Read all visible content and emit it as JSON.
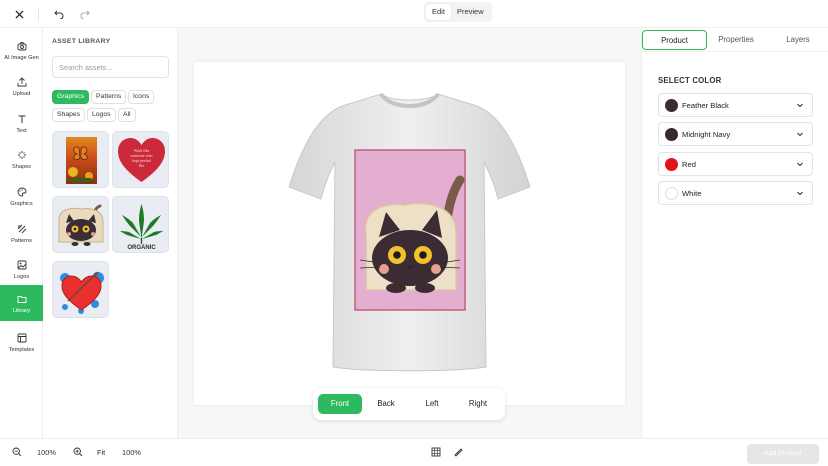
{
  "topbar": {
    "close_icon": "close-icon",
    "undo_icon": "undo-icon",
    "redo_icon": "redo-icon",
    "modes": [
      "Edit",
      "Preview"
    ],
    "active_mode": "Edit"
  },
  "rail": {
    "items": [
      {
        "label": "AI Image Gen",
        "icon": "ai-image-icon"
      },
      {
        "label": "Upload",
        "icon": "upload-icon"
      },
      {
        "label": "Text",
        "icon": "text-icon"
      },
      {
        "label": "Shapes",
        "icon": "shapes-icon"
      },
      {
        "label": "Graphics",
        "icon": "palette-icon"
      },
      {
        "label": "Patterns",
        "icon": "patterns-icon"
      },
      {
        "label": "Logos",
        "icon": "image-icon"
      },
      {
        "label": "Library",
        "icon": "folder-icon"
      },
      {
        "label": "Templates",
        "icon": "templates-icon"
      }
    ],
    "active": "Library"
  },
  "assets": {
    "title": "ASSET LIBRARY",
    "search_placeholder": "Search assets...",
    "filters": [
      "Graphics",
      "Patterns",
      "Icons",
      "Shapes",
      "Logos",
      "All"
    ],
    "active_filter": "Graphics",
    "thumbnails": [
      "butterfly-flowers",
      "heart-with-text",
      "cat-in-bread",
      "cannabis-leaf-organic",
      "heart-arrow-splash"
    ],
    "thumb_text": {
      "heart_text": "Work like someone who kept peeled life",
      "organic": "ORGANIC"
    }
  },
  "canvas": {
    "views": [
      "Front",
      "Back",
      "Left",
      "Right"
    ],
    "active_view": "Front",
    "colors": {
      "shirt": "#ededed",
      "print_bg": "#e3aed0",
      "print_border": "#c0607e"
    }
  },
  "rpanel": {
    "tabs": [
      "Product",
      "Properties",
      "Layers"
    ],
    "active_tab": "Product",
    "section_title": "SELECT COLOR",
    "colors": [
      {
        "name": "Feather Black",
        "hex": "#3a2e2c"
      },
      {
        "name": "Midnight Navy",
        "hex": "#352a29"
      },
      {
        "name": "Red",
        "hex": "#e0141b"
      },
      {
        "name": "White",
        "hex": "#ffffff"
      }
    ]
  },
  "bottombar": {
    "zoom_out_icon": "zoom-out-icon",
    "zoom_value": "100%",
    "zoom_in_icon": "zoom-in-icon",
    "fit_label": "Fit",
    "fit_value": "100%",
    "grid_icon": "grid-icon",
    "ruler_icon": "ruler-icon",
    "add_button": "Add Product"
  },
  "accent": "#2dba5e"
}
